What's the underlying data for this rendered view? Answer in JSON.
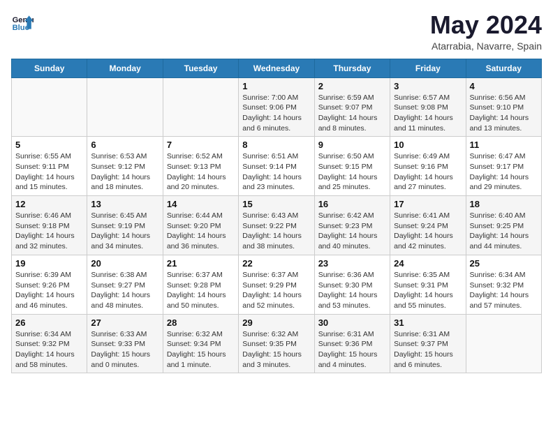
{
  "header": {
    "logo_line1": "General",
    "logo_line2": "Blue",
    "title": "May 2024",
    "subtitle": "Atarrabia, Navarre, Spain"
  },
  "weekdays": [
    "Sunday",
    "Monday",
    "Tuesday",
    "Wednesday",
    "Thursday",
    "Friday",
    "Saturday"
  ],
  "weeks": [
    [
      {
        "day": "",
        "info": ""
      },
      {
        "day": "",
        "info": ""
      },
      {
        "day": "",
        "info": ""
      },
      {
        "day": "1",
        "info": "Sunrise: 7:00 AM\nSunset: 9:06 PM\nDaylight: 14 hours\nand 6 minutes."
      },
      {
        "day": "2",
        "info": "Sunrise: 6:59 AM\nSunset: 9:07 PM\nDaylight: 14 hours\nand 8 minutes."
      },
      {
        "day": "3",
        "info": "Sunrise: 6:57 AM\nSunset: 9:08 PM\nDaylight: 14 hours\nand 11 minutes."
      },
      {
        "day": "4",
        "info": "Sunrise: 6:56 AM\nSunset: 9:10 PM\nDaylight: 14 hours\nand 13 minutes."
      }
    ],
    [
      {
        "day": "5",
        "info": "Sunrise: 6:55 AM\nSunset: 9:11 PM\nDaylight: 14 hours\nand 15 minutes."
      },
      {
        "day": "6",
        "info": "Sunrise: 6:53 AM\nSunset: 9:12 PM\nDaylight: 14 hours\nand 18 minutes."
      },
      {
        "day": "7",
        "info": "Sunrise: 6:52 AM\nSunset: 9:13 PM\nDaylight: 14 hours\nand 20 minutes."
      },
      {
        "day": "8",
        "info": "Sunrise: 6:51 AM\nSunset: 9:14 PM\nDaylight: 14 hours\nand 23 minutes."
      },
      {
        "day": "9",
        "info": "Sunrise: 6:50 AM\nSunset: 9:15 PM\nDaylight: 14 hours\nand 25 minutes."
      },
      {
        "day": "10",
        "info": "Sunrise: 6:49 AM\nSunset: 9:16 PM\nDaylight: 14 hours\nand 27 minutes."
      },
      {
        "day": "11",
        "info": "Sunrise: 6:47 AM\nSunset: 9:17 PM\nDaylight: 14 hours\nand 29 minutes."
      }
    ],
    [
      {
        "day": "12",
        "info": "Sunrise: 6:46 AM\nSunset: 9:18 PM\nDaylight: 14 hours\nand 32 minutes."
      },
      {
        "day": "13",
        "info": "Sunrise: 6:45 AM\nSunset: 9:19 PM\nDaylight: 14 hours\nand 34 minutes."
      },
      {
        "day": "14",
        "info": "Sunrise: 6:44 AM\nSunset: 9:20 PM\nDaylight: 14 hours\nand 36 minutes."
      },
      {
        "day": "15",
        "info": "Sunrise: 6:43 AM\nSunset: 9:22 PM\nDaylight: 14 hours\nand 38 minutes."
      },
      {
        "day": "16",
        "info": "Sunrise: 6:42 AM\nSunset: 9:23 PM\nDaylight: 14 hours\nand 40 minutes."
      },
      {
        "day": "17",
        "info": "Sunrise: 6:41 AM\nSunset: 9:24 PM\nDaylight: 14 hours\nand 42 minutes."
      },
      {
        "day": "18",
        "info": "Sunrise: 6:40 AM\nSunset: 9:25 PM\nDaylight: 14 hours\nand 44 minutes."
      }
    ],
    [
      {
        "day": "19",
        "info": "Sunrise: 6:39 AM\nSunset: 9:26 PM\nDaylight: 14 hours\nand 46 minutes."
      },
      {
        "day": "20",
        "info": "Sunrise: 6:38 AM\nSunset: 9:27 PM\nDaylight: 14 hours\nand 48 minutes."
      },
      {
        "day": "21",
        "info": "Sunrise: 6:37 AM\nSunset: 9:28 PM\nDaylight: 14 hours\nand 50 minutes."
      },
      {
        "day": "22",
        "info": "Sunrise: 6:37 AM\nSunset: 9:29 PM\nDaylight: 14 hours\nand 52 minutes."
      },
      {
        "day": "23",
        "info": "Sunrise: 6:36 AM\nSunset: 9:30 PM\nDaylight: 14 hours\nand 53 minutes."
      },
      {
        "day": "24",
        "info": "Sunrise: 6:35 AM\nSunset: 9:31 PM\nDaylight: 14 hours\nand 55 minutes."
      },
      {
        "day": "25",
        "info": "Sunrise: 6:34 AM\nSunset: 9:32 PM\nDaylight: 14 hours\nand 57 minutes."
      }
    ],
    [
      {
        "day": "26",
        "info": "Sunrise: 6:34 AM\nSunset: 9:32 PM\nDaylight: 14 hours\nand 58 minutes."
      },
      {
        "day": "27",
        "info": "Sunrise: 6:33 AM\nSunset: 9:33 PM\nDaylight: 15 hours\nand 0 minutes."
      },
      {
        "day": "28",
        "info": "Sunrise: 6:32 AM\nSunset: 9:34 PM\nDaylight: 15 hours\nand 1 minute."
      },
      {
        "day": "29",
        "info": "Sunrise: 6:32 AM\nSunset: 9:35 PM\nDaylight: 15 hours\nand 3 minutes."
      },
      {
        "day": "30",
        "info": "Sunrise: 6:31 AM\nSunset: 9:36 PM\nDaylight: 15 hours\nand 4 minutes."
      },
      {
        "day": "31",
        "info": "Sunrise: 6:31 AM\nSunset: 9:37 PM\nDaylight: 15 hours\nand 6 minutes."
      },
      {
        "day": "",
        "info": ""
      }
    ]
  ]
}
